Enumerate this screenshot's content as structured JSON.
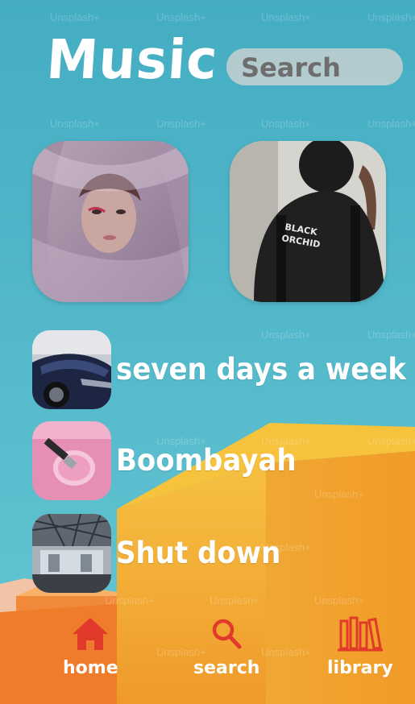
{
  "app": {
    "title": "Music"
  },
  "search": {
    "placeholder": "Search"
  },
  "watermark": "Unsplash+",
  "featured": [
    {
      "name": "featured-card-portrait-veil"
    },
    {
      "name": "featured-card-black-orchid-shirt"
    }
  ],
  "songs": [
    {
      "title": "seven days a week",
      "thumb": "sports-car"
    },
    {
      "title": "Boombayah",
      "thumb": "paint-brush-pink"
    },
    {
      "title": "Shut down",
      "thumb": "building-interior"
    }
  ],
  "nav": {
    "home": "home",
    "search": "search",
    "library": "library"
  },
  "colors": {
    "sky": "#4fb8c9",
    "orange_building": "#f5a72b",
    "nav_icon_red": "#e23a2a",
    "text_white": "#ffffff",
    "search_bg": "#d2d2d2"
  }
}
